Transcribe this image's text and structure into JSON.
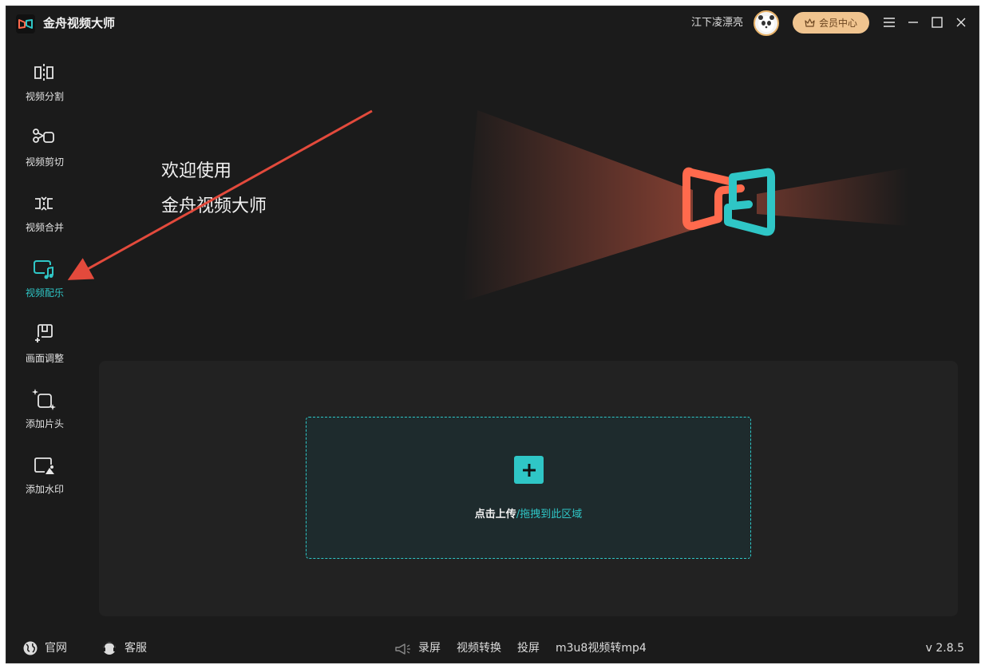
{
  "app": {
    "title": "金舟视频大师"
  },
  "header": {
    "username": "江下凌漂亮",
    "vip_label": "会员中心"
  },
  "sidebar": {
    "items": [
      {
        "label": "视频分割",
        "icon": "video-split-icon",
        "active": false
      },
      {
        "label": "视频剪切",
        "icon": "scissors-icon",
        "active": false
      },
      {
        "label": "视频合并",
        "icon": "merge-icon",
        "active": false
      },
      {
        "label": "视频配乐",
        "icon": "music-note-icon",
        "active": true
      },
      {
        "label": "画面调整",
        "icon": "frame-adjust-icon",
        "active": false
      },
      {
        "label": "添加片头",
        "icon": "sparkle-frame-icon",
        "active": false
      },
      {
        "label": "添加水印",
        "icon": "image-watermark-icon",
        "active": false
      }
    ]
  },
  "hero": {
    "line1": "欢迎使用",
    "line2": "金舟视频大师"
  },
  "upload": {
    "primary": "点击上传",
    "secondary": "/拖拽到此区域"
  },
  "footer": {
    "website": "官网",
    "support": "客服",
    "links": [
      "录屏",
      "视频转换",
      "投屏",
      "m3u8视频转mp4"
    ],
    "version": "v 2.8.5"
  },
  "colors": {
    "accent": "#2fc6c6",
    "brand_orange": "#ff6a4d",
    "background": "#1b1b1b",
    "vip": "#f0c48f"
  }
}
